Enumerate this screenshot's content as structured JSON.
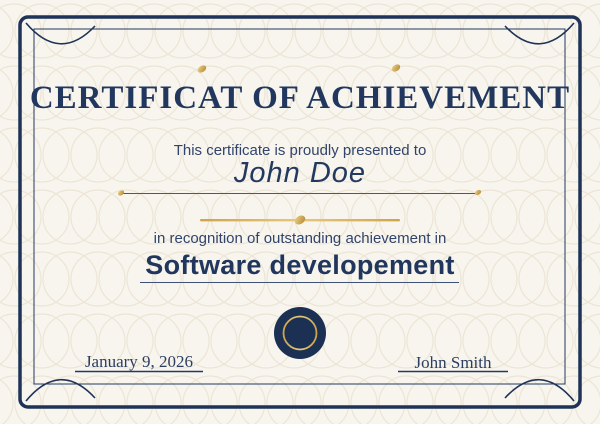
{
  "certificate": {
    "title": "CERTIFICAT OF ACHIEVEMENT",
    "presented_text": "This certificate is proudly presented to",
    "recipient_name": "John Doe",
    "recognition_text": "in recognition of outstanding achievement in",
    "achievement_title": "Software developement",
    "date": "January 9, 2026",
    "signer_name": "John Smith"
  },
  "icons": {
    "seal": "seal-icon",
    "sparkle": "sparkle-icon",
    "corner_flourish": "corner-flourish-icon"
  },
  "colors": {
    "background": "#f8f5ee",
    "pattern": "#ece5d6",
    "navy_border": "#1e3357",
    "navy_text": "#21375e",
    "gold": "#c79d42",
    "gold_light": "#e8cc82"
  }
}
